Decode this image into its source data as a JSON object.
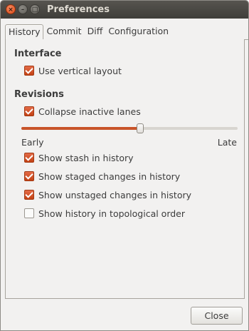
{
  "window": {
    "title": "Preferences",
    "controls": {
      "close": "×",
      "minimize": "–",
      "maximize": "□"
    }
  },
  "tabs": [
    {
      "label": "History",
      "active": true
    },
    {
      "label": "Commit",
      "active": false
    },
    {
      "label": "Diff",
      "active": false
    },
    {
      "label": "Configuration",
      "active": false
    }
  ],
  "interface": {
    "heading": "Interface",
    "use_vertical_layout": {
      "label": "Use vertical layout",
      "checked": true
    }
  },
  "revisions": {
    "heading": "Revisions",
    "collapse_inactive_lanes": {
      "label": "Collapse inactive lanes",
      "checked": true
    },
    "slider": {
      "min_label": "Early",
      "max_label": "Late",
      "value": 0.55
    },
    "options": [
      {
        "label": "Show stash in history",
        "checked": true
      },
      {
        "label": "Show staged changes in history",
        "checked": true
      },
      {
        "label": "Show unstaged changes in history",
        "checked": true
      },
      {
        "label": "Show history in topological order",
        "checked": false
      }
    ]
  },
  "footer": {
    "close_label": "Close"
  },
  "colors": {
    "accent": "#c8542a",
    "titlebar": "#3f3e3a",
    "background": "#f2f1f0"
  }
}
